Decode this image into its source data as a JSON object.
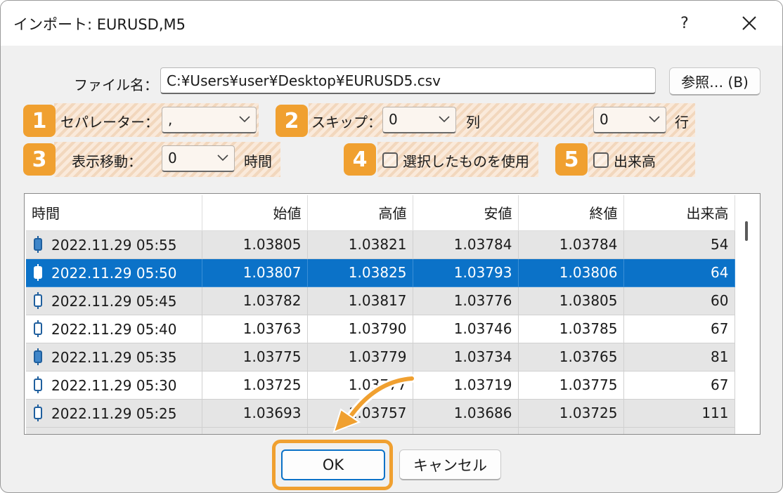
{
  "window": {
    "title": "インポート: EURUSD,M5",
    "help_label": "?",
    "close_icon": "close-icon"
  },
  "file": {
    "label": "ファイル名：",
    "path": "C:¥Users¥user¥Desktop¥EURUSD5.csv",
    "browse_label": "参照… (B)"
  },
  "options": {
    "separator": {
      "badge": "1",
      "label": "セパレーター：",
      "value": ","
    },
    "skip": {
      "badge": "2",
      "label": "スキップ：",
      "columns_value": "0",
      "columns_unit": "列",
      "rows_value": "0",
      "rows_unit": "行"
    },
    "shift": {
      "badge": "3",
      "label": "表示移動：",
      "value": "0",
      "unit": "時間"
    },
    "use_selected": {
      "badge": "4",
      "label": "選択したものを使用",
      "checked": false
    },
    "volume": {
      "badge": "5",
      "label": "出来高",
      "checked": false
    }
  },
  "table": {
    "columns": [
      "時間",
      "始値",
      "高値",
      "安値",
      "終値",
      "出来高"
    ],
    "rows": [
      {
        "time": "2022.11.29 05:55",
        "open": "1.03805",
        "high": "1.03821",
        "low": "1.03784",
        "close": "1.03784",
        "volume": "54",
        "candle": "bearish"
      },
      {
        "time": "2022.11.29 05:50",
        "open": "1.03807",
        "high": "1.03825",
        "low": "1.03793",
        "close": "1.03806",
        "volume": "64",
        "candle": "bearish"
      },
      {
        "time": "2022.11.29 05:45",
        "open": "1.03782",
        "high": "1.03817",
        "low": "1.03776",
        "close": "1.03805",
        "volume": "60",
        "candle": "bullish"
      },
      {
        "time": "2022.11.29 05:40",
        "open": "1.03763",
        "high": "1.03790",
        "low": "1.03746",
        "close": "1.03785",
        "volume": "67",
        "candle": "bullish"
      },
      {
        "time": "2022.11.29 05:35",
        "open": "1.03775",
        "high": "1.03779",
        "low": "1.03734",
        "close": "1.03765",
        "volume": "81",
        "candle": "bearish"
      },
      {
        "time": "2022.11.29 05:30",
        "open": "1.03725",
        "high": "1.03777",
        "low": "1.03719",
        "close": "1.03775",
        "volume": "67",
        "candle": "bullish"
      },
      {
        "time": "2022.11.29 05:25",
        "open": "1.03693",
        "high": "1.03757",
        "low": "1.03686",
        "close": "1.03725",
        "volume": "111",
        "candle": "bullish"
      }
    ],
    "selected_row_index": 1
  },
  "buttons": {
    "ok_label": "OK",
    "cancel_label": "キャンセル"
  },
  "colors": {
    "accent": "#f0a030",
    "selection": "#0b72c8",
    "candle_fill": "#3f86c9"
  }
}
